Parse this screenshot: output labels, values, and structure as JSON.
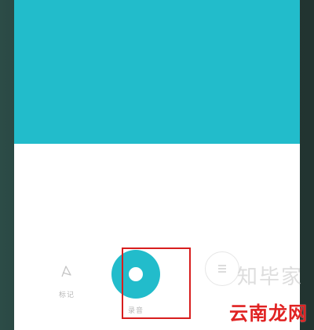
{
  "colors": {
    "accent": "#22bccb",
    "highlight": "#d81e1e",
    "watermark_red": "#e02222"
  },
  "controls": {
    "mark": {
      "label": "标记",
      "icon": "flag-icon"
    },
    "record": {
      "label": "录音",
      "icon": "record-icon"
    },
    "list": {
      "label": "",
      "icon": "list-icon"
    }
  },
  "watermark": {
    "top": "知毕家",
    "bottom": "云南龙网"
  }
}
